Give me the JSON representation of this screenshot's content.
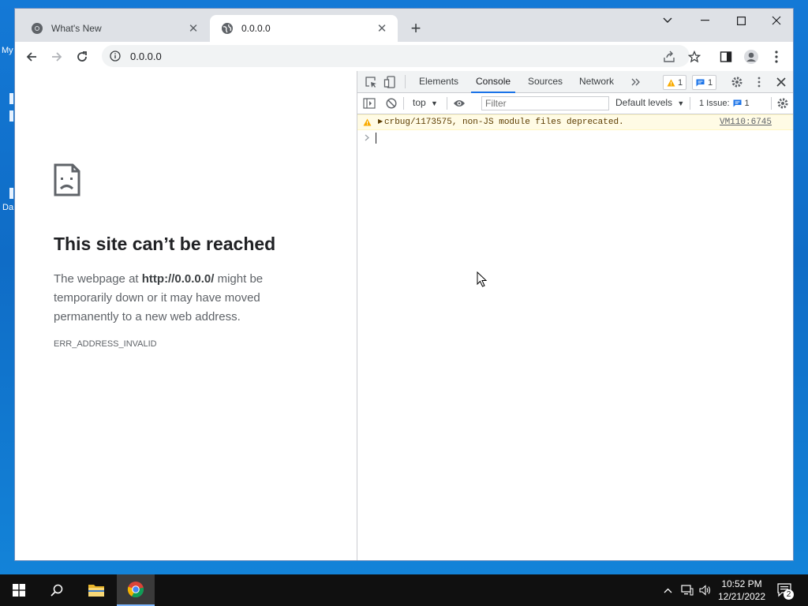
{
  "desktop": {
    "labels": [
      "My",
      "Da"
    ]
  },
  "browser": {
    "tabs": [
      {
        "title": "What's New",
        "icon": "chrome-icon",
        "active": false
      },
      {
        "title": "0.0.0.0",
        "icon": "globe-icon",
        "active": true
      }
    ],
    "address": "0.0.0.0"
  },
  "error_page": {
    "title": "This site can’t be reached",
    "body_prefix": "The webpage at ",
    "body_url": "http://0.0.0.0/",
    "body_suffix": " might be temporarily down or it may have moved permanently to a new web address.",
    "code": "ERR_ADDRESS_INVALID"
  },
  "devtools": {
    "tabs": [
      "Elements",
      "Console",
      "Sources",
      "Network"
    ],
    "active_tab": "Console",
    "warning_count": "1",
    "message_count": "1",
    "context": "top",
    "filter_placeholder": "Filter",
    "levels": "Default levels",
    "issues_label": "1 Issue:",
    "issues_count": "1",
    "console": {
      "warning_text": "crbug/1173575, non-JS module files deprecated.",
      "warning_source": "VM110:6745"
    }
  },
  "taskbar": {
    "time": "10:52 PM",
    "date": "12/21/2022",
    "notification_count": "2"
  },
  "colors": {
    "accent": "#1a73e8",
    "warning_bg": "#fffbe5",
    "warning_icon": "#f9ab00"
  }
}
